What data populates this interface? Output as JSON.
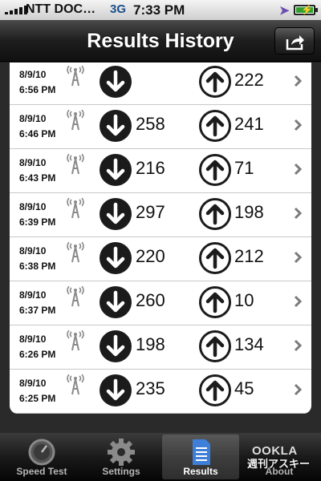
{
  "status_bar": {
    "carrier": "NTT DOC…",
    "network": "3G",
    "time": "7:33 PM"
  },
  "nav": {
    "title": "Results History",
    "share_icon": "share-icon"
  },
  "results": [
    {
      "date": "8/9/10",
      "time": "6:56 PM",
      "download": "",
      "upload": "222"
    },
    {
      "date": "8/9/10",
      "time": "6:46 PM",
      "download": "258",
      "upload": "241"
    },
    {
      "date": "8/9/10",
      "time": "6:43 PM",
      "download": "216",
      "upload": "71"
    },
    {
      "date": "8/9/10",
      "time": "6:39 PM",
      "download": "297",
      "upload": "198"
    },
    {
      "date": "8/9/10",
      "time": "6:38 PM",
      "download": "220",
      "upload": "212"
    },
    {
      "date": "8/9/10",
      "time": "6:37 PM",
      "download": "260",
      "upload": "10"
    },
    {
      "date": "8/9/10",
      "time": "6:26 PM",
      "download": "198",
      "upload": "134"
    },
    {
      "date": "8/9/10",
      "time": "6:25 PM",
      "download": "235",
      "upload": "45"
    }
  ],
  "tabs": [
    {
      "label": "Speed Test",
      "icon": "speedometer-icon",
      "active": false
    },
    {
      "label": "Settings",
      "icon": "gear-icon",
      "active": false
    },
    {
      "label": "Results",
      "icon": "document-icon",
      "active": true
    },
    {
      "label": "About",
      "icon": "ookla-logo",
      "active": false
    }
  ],
  "about_logo": "OOKLA",
  "watermark": "週刊アスキー",
  "colors": {
    "active_tab_icon": "#3d7fd9",
    "battery": "#2f9e2f"
  }
}
